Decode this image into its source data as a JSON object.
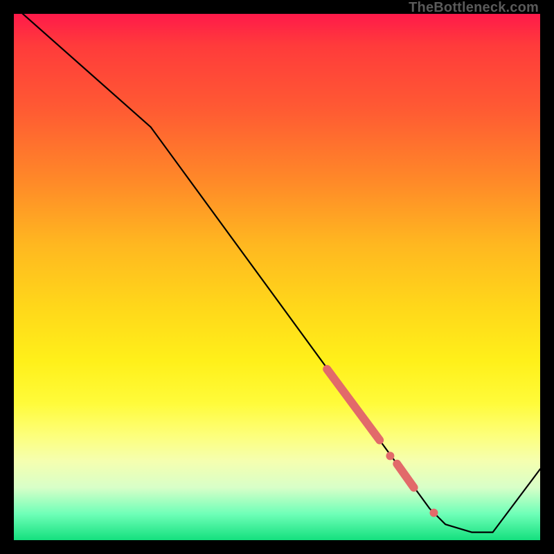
{
  "credit": "TheBottleneck.com",
  "chart_data": {
    "type": "line",
    "title": "",
    "xlabel": "",
    "ylabel": "",
    "xlim": [
      0,
      100
    ],
    "ylim": [
      0,
      100
    ],
    "note": "Axes are unlabeled in the source image; values are fractional positions (0–100) estimated from pixel geometry.",
    "curve": [
      {
        "x": 0.0,
        "y": 101.5
      },
      {
        "x": 26.0,
        "y": 78.5
      },
      {
        "x": 79.0,
        "y": 6.0
      },
      {
        "x": 82.0,
        "y": 3.0
      },
      {
        "x": 87.0,
        "y": 1.5
      },
      {
        "x": 91.0,
        "y": 1.5
      },
      {
        "x": 100.0,
        "y": 13.5
      }
    ],
    "highlights": [
      {
        "kind": "segment",
        "x1": 59.5,
        "y1": 32.5,
        "x2": 69.5,
        "y2": 19.0
      },
      {
        "kind": "dot",
        "x": 71.5,
        "y": 16.0
      },
      {
        "kind": "segment",
        "x1": 72.8,
        "y1": 14.5,
        "x2": 76.0,
        "y2": 10.0
      },
      {
        "kind": "dot",
        "x": 79.8,
        "y": 5.2
      }
    ],
    "highlight_color": "#e26a6a",
    "background_gradient": [
      "#ff1a4a",
      "#ffd81a",
      "#fff01a",
      "#14e07e"
    ]
  }
}
